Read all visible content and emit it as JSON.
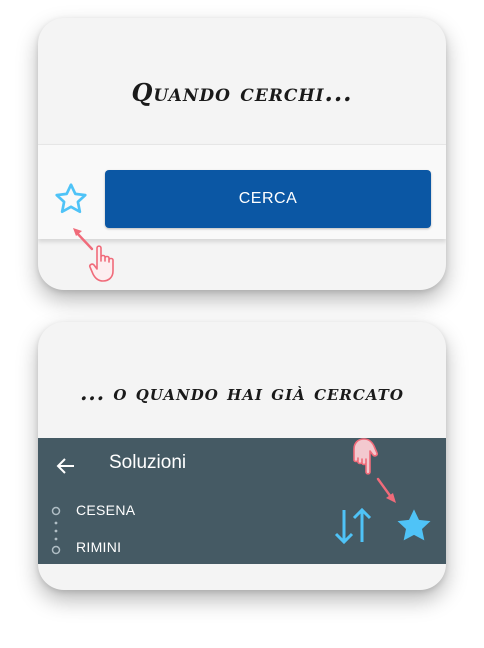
{
  "panel_search": {
    "heading": "Quando cerchi...",
    "search_button_label": "CERCA",
    "favorite_icon": "star-outline-icon",
    "pointer_icon": "pointing-hand-icon"
  },
  "panel_results": {
    "heading": "... o quando hai già cercato",
    "appbar": {
      "back_icon": "arrow-left-icon",
      "title": "Soluzioni"
    },
    "route": {
      "from": "CESENA",
      "to": "RIMINI"
    },
    "swap_icon": "swap-vertical-icon",
    "favorite_icon": "star-filled-icon"
  },
  "colors": {
    "primary_button": "#0b57a4",
    "appbar": "#455a64",
    "star": "#4fc3f7",
    "pointer": "#f06b7a",
    "card_bg": "#f4f4f4"
  }
}
